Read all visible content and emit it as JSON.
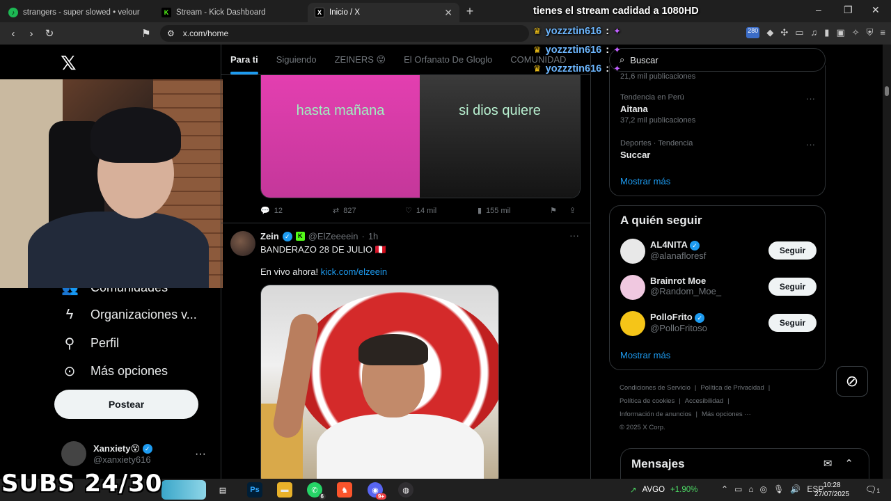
{
  "browser": {
    "tabs": [
      {
        "icon": "spotify-icon",
        "title": "strangers - super slowed • velour",
        "active": false
      },
      {
        "icon": "kick-icon",
        "title": "Stream - Kick Dashboard",
        "active": false
      },
      {
        "icon": "x-icon",
        "title": "Inicio / X",
        "active": true
      }
    ],
    "url": "x.com/home",
    "extension_badge": "280"
  },
  "sidebar": {
    "items": [
      {
        "label": "Comunidades",
        "icon": "people-icon"
      },
      {
        "label": "Organizaciones v...",
        "icon": "lightning-icon"
      },
      {
        "label": "Perfil",
        "icon": "person-icon"
      },
      {
        "label": "Más opciones",
        "icon": "more-circle-icon"
      }
    ],
    "post_label": "Postear",
    "account": {
      "name": "Xanxiety",
      "name_emoji": "😵",
      "handle": "@xanxiety616"
    }
  },
  "feed": {
    "tabs": [
      "Para ti",
      "Siguiendo",
      "ZEINERS 😝",
      "El Orfanato De Gloglo",
      "COMUNIDAD"
    ],
    "active_tab": "Para ti",
    "tweet1": {
      "caption_left": "hasta mañana",
      "caption_right": "si dios quiere",
      "replies": "12",
      "reposts": "827",
      "likes": "14 mil",
      "views": "155 mil"
    },
    "tweet2": {
      "name": "Zein",
      "handle": "@ElZeeeein",
      "time": "1h",
      "text": "BANDERAZO 28 DE JULIO",
      "flag": "🇵🇪",
      "live_prefix": "En vivo ahora!",
      "live_link": "kick.com/elzeein"
    }
  },
  "right": {
    "search_placeholder": "Buscar",
    "trends": [
      {
        "meta": "",
        "topic": "",
        "count": "21,6 mil publicaciones"
      },
      {
        "meta": "Tendencia en Perú",
        "topic": "Aitana",
        "count": "37,2 mil publicaciones"
      },
      {
        "meta": "Deportes · Tendencia",
        "topic": "Succar",
        "count": ""
      }
    ],
    "show_more": "Mostrar más",
    "who_title": "A quién seguir",
    "follow_label": "Seguir",
    "suggestions": [
      {
        "name": "AL4NITA",
        "handle": "@alanafloresf",
        "verified": true
      },
      {
        "name": "Brainrot Moe",
        "handle": "@Random_Moe_",
        "verified": false
      },
      {
        "name": "PolloFrito",
        "handle": "@PolloFritoso",
        "verified": true
      }
    ],
    "footer": [
      "Condiciones de Servicio",
      "Política de Privacidad",
      "Política de cookies",
      "Accesibilidad",
      "Información de anuncios",
      "Más opciones ···",
      "© 2025 X Corp."
    ],
    "messages_title": "Mensajes"
  },
  "overlay": {
    "chat_header": "tienes el stream cadidad a 1080HD",
    "chat_users": [
      "yozzztin616",
      "yozzztin616",
      "yozzztin616"
    ],
    "subs_text": "SUBS 24/30"
  },
  "taskbar": {
    "whatsapp_badge": "6",
    "discord_badge": "9+",
    "stock_ticker": "AVGO",
    "stock_change": "+1.90%",
    "lang": "ESP",
    "time": "10:28",
    "date": "27/07/2025",
    "notifications": "1"
  },
  "colors": {
    "accent": "#1d9bf0",
    "kick_green": "#53fc18",
    "background": "#000000"
  }
}
